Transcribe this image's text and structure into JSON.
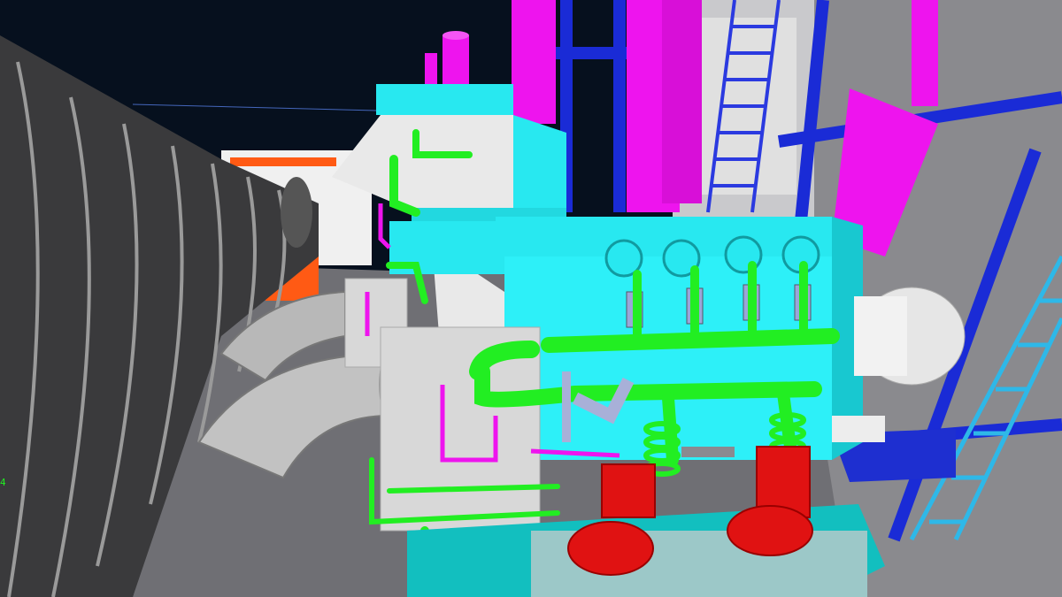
{
  "scene": {
    "edge_marker_text": "4",
    "colors": {
      "background": "#06101e",
      "floor": "#6f6f74",
      "wall": "#8a8a8e",
      "duct": "#3a3a3c",
      "duct_band": "#9a9a9a",
      "elbow": "#b8b8b8",
      "engine_body": "#28e8f0",
      "engine_light": "#e9e9e9",
      "green_pipe": "#22ee22",
      "magenta": "#ee14ee",
      "blue_structure": "#1a2bd6",
      "ladder_cyan": "#2eb8e8",
      "pump_red": "#e01212",
      "orange": "#ff5a14",
      "base_cyan": "#12bfbf"
    }
  }
}
